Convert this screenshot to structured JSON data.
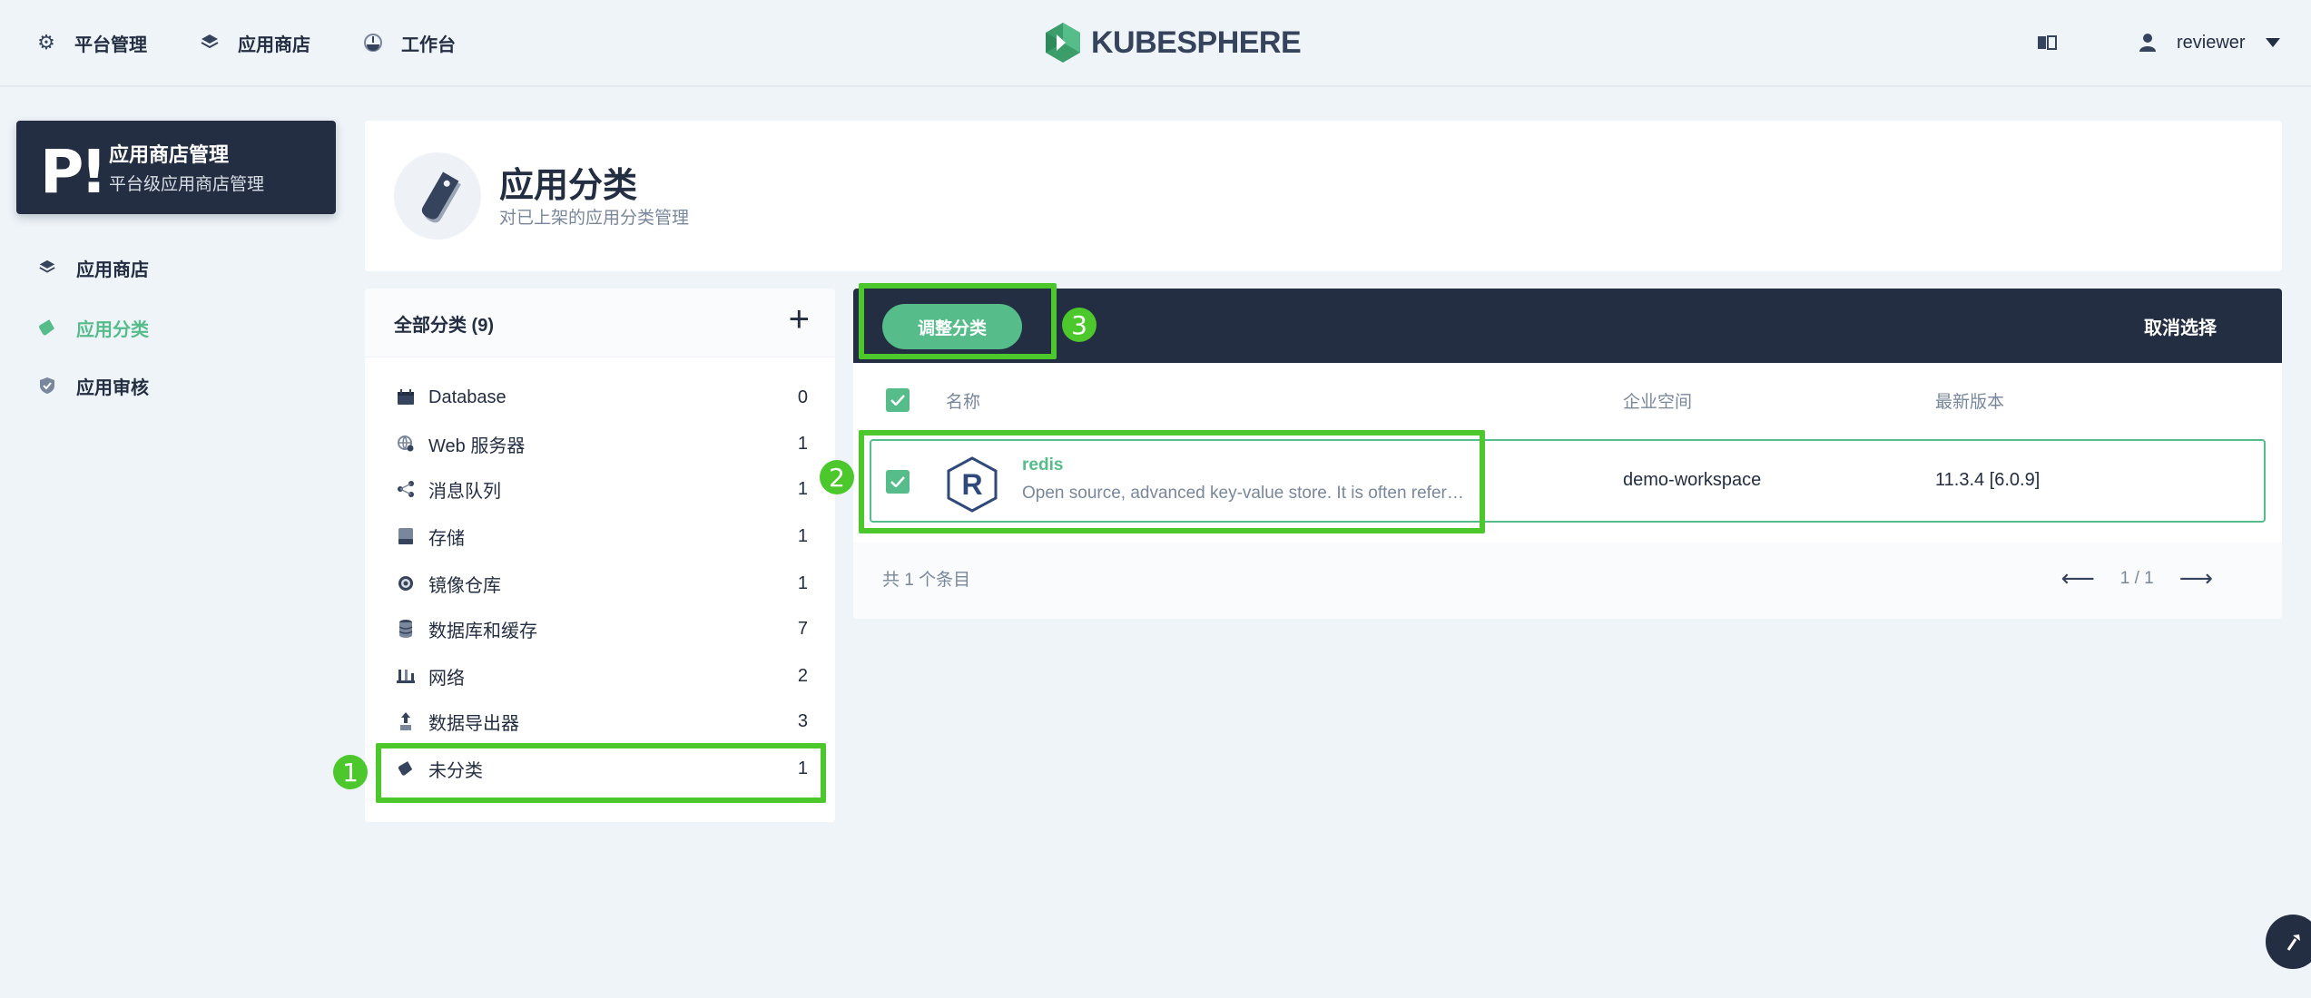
{
  "topnav": {
    "items": [
      {
        "label": "平台管理",
        "icon": "gear-icon"
      },
      {
        "label": "应用商店",
        "icon": "layers-icon"
      },
      {
        "label": "工作台",
        "icon": "dashboard-icon"
      }
    ],
    "logo_text": "KUBESPHERE",
    "user": "reviewer"
  },
  "sidebar": {
    "card_initials": "P!",
    "card_title": "应用商店管理",
    "card_subtitle": "平台级应用商店管理",
    "items": [
      {
        "label": "应用商店",
        "icon": "layers-icon"
      },
      {
        "label": "应用分类",
        "icon": "tag-icon",
        "active": true
      },
      {
        "label": "应用审核",
        "icon": "shield-icon"
      }
    ]
  },
  "header": {
    "title": "应用分类",
    "description": "对已上架的应用分类管理"
  },
  "categories": {
    "header": "全部分类 (9)",
    "items": [
      {
        "name": "Database",
        "count": "0",
        "icon": "calendar-icon"
      },
      {
        "name": "Web 服务器",
        "count": "1",
        "icon": "globe-icon"
      },
      {
        "name": "消息队列",
        "count": "1",
        "icon": "share-icon"
      },
      {
        "name": "存储",
        "count": "1",
        "icon": "storage-icon"
      },
      {
        "name": "镜像仓库",
        "count": "1",
        "icon": "disc-icon"
      },
      {
        "name": "数据库和缓存",
        "count": "7",
        "icon": "database-icon"
      },
      {
        "name": "网络",
        "count": "2",
        "icon": "network-icon"
      },
      {
        "name": "数据导出器",
        "count": "3",
        "icon": "export-icon"
      },
      {
        "name": "未分类",
        "count": "1",
        "icon": "tag-icon"
      }
    ]
  },
  "list": {
    "adjust_button": "调整分类",
    "cancel_selection": "取消选择",
    "columns": [
      "名称",
      "企业空间",
      "最新版本"
    ],
    "rows": [
      {
        "name": "redis",
        "description": "Open source, advanced key-value store. It is often referred to as a data structure server",
        "workspace": "demo-workspace",
        "version": "11.3.4 [6.0.9]",
        "logo_letter": "R"
      }
    ],
    "total": "共 1 个条目",
    "pagination": "1 / 1"
  },
  "annotations": [
    "1",
    "2",
    "3"
  ],
  "colors": {
    "accent": "#55bc8a",
    "dark": "#242e42",
    "highlight": "#4cc72c",
    "background": "#eff4f9"
  }
}
